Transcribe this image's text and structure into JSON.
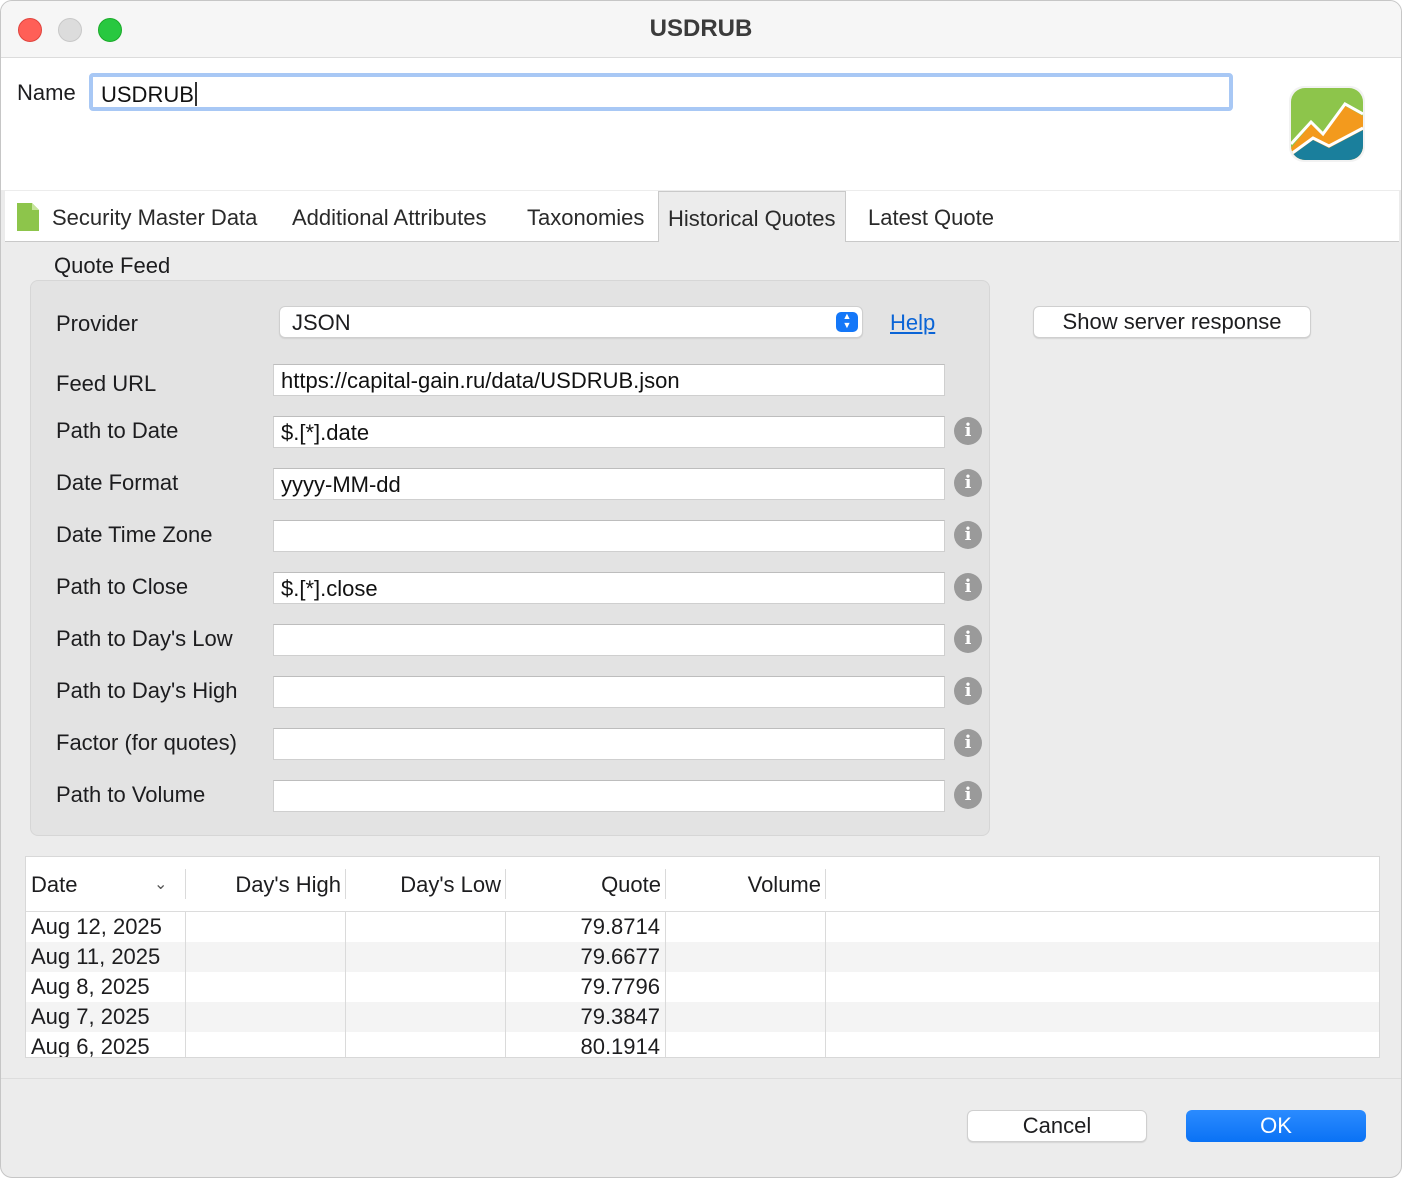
{
  "window": {
    "title": "USDRUB"
  },
  "name": {
    "label": "Name",
    "value": "USDRUB"
  },
  "tabs": [
    {
      "label": "Security Master Data"
    },
    {
      "label": "Additional Attributes"
    },
    {
      "label": "Taxonomies"
    },
    {
      "label": "Historical Quotes",
      "active": true
    },
    {
      "label": "Latest Quote"
    }
  ],
  "quote_feed": {
    "section_label": "Quote Feed",
    "provider_label": "Provider",
    "provider_value": "JSON",
    "help_label": "Help",
    "show_server_response": "Show server response",
    "fields": [
      {
        "label": "Feed URL",
        "value": "https://capital-gain.ru/data/USDRUB.json",
        "info": false
      },
      {
        "label": "Path to Date",
        "value": "$.[*].date",
        "info": true
      },
      {
        "label": "Date Format",
        "value": "yyyy-MM-dd",
        "info": true
      },
      {
        "label": "Date Time Zone",
        "value": "",
        "info": true
      },
      {
        "label": "Path to Close",
        "value": "$.[*].close",
        "info": true
      },
      {
        "label": "Path to Day's Low",
        "value": "",
        "info": true
      },
      {
        "label": "Path to Day's High",
        "value": "",
        "info": true
      },
      {
        "label": "Factor (for quotes)",
        "value": "",
        "info": true
      },
      {
        "label": "Path to Volume",
        "value": "",
        "info": true
      }
    ]
  },
  "table": {
    "columns": [
      "Date",
      "Day's High",
      "Day's Low",
      "Quote",
      "Volume"
    ],
    "rows": [
      {
        "date": "Aug 12, 2025",
        "high": "",
        "low": "",
        "quote": "79.8714",
        "volume": ""
      },
      {
        "date": "Aug 11, 2025",
        "high": "",
        "low": "",
        "quote": "79.6677",
        "volume": ""
      },
      {
        "date": "Aug 8, 2025",
        "high": "",
        "low": "",
        "quote": "79.7796",
        "volume": ""
      },
      {
        "date": "Aug 7, 2025",
        "high": "",
        "low": "",
        "quote": "79.3847",
        "volume": ""
      },
      {
        "date": "Aug 6, 2025",
        "high": "",
        "low": "",
        "quote": "80.1914",
        "volume": ""
      }
    ]
  },
  "buttons": {
    "cancel": "Cancel",
    "ok": "OK"
  },
  "colors": {
    "accent": "#0a72f5",
    "link": "#0a64d6"
  }
}
